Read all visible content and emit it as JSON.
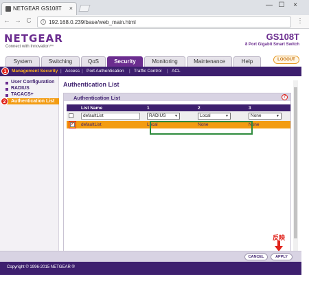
{
  "browser": {
    "tab_title": "NETGEAR GS108T",
    "tab_close": "×",
    "url": "192.168.0.239/base/web_main.html",
    "window_controls": [
      "—",
      "☐",
      "×"
    ],
    "nav": [
      "←",
      "→",
      "C"
    ]
  },
  "header": {
    "logo": "NETGEAR",
    "logo_tagline": "Connect with Innovation™",
    "model": "GS108T",
    "model_desc": "8 Port Gigabit Smart Switch",
    "logout_label": "LOGOUT"
  },
  "main_tabs": [
    "System",
    "Switching",
    "QoS",
    "Security",
    "Monitoring",
    "Maintenance",
    "Help"
  ],
  "active_tab": "Security",
  "sub_nav": {
    "items": [
      "Management Security",
      "Access",
      "Port Authentication",
      "Traffic Control",
      "ACL"
    ],
    "separator": "|"
  },
  "markers": [
    "1",
    "2"
  ],
  "sidebar": {
    "items": [
      "User Configuration",
      "RADIUS",
      "TACACS+",
      "Authentication List"
    ]
  },
  "content": {
    "title": "Authentication List",
    "panel_title": "Authentication List",
    "help_icon": "?",
    "columns": [
      "",
      "List Name",
      "1",
      "2",
      "3"
    ],
    "edit_row": {
      "name_value": "defaultList",
      "method1": "RADIUS",
      "method2": "Local",
      "method3": "None"
    },
    "rows": [
      {
        "checked": true,
        "name": "defaultList",
        "m1": "Local",
        "m2": "None",
        "m3": "None"
      }
    ]
  },
  "buttons": {
    "cancel": "CANCEL",
    "apply": "APPLY"
  },
  "annotation_text": "反映",
  "footer": "Copyright © 1996-2015 NETGEAR ®",
  "colors": {
    "brand_purple": "#6b2d8f",
    "dark_purple": "#3d1f6e",
    "accent_orange": "#f39c12",
    "marker_red": "#e0221a",
    "highlight_green": "#2e8b3d"
  }
}
